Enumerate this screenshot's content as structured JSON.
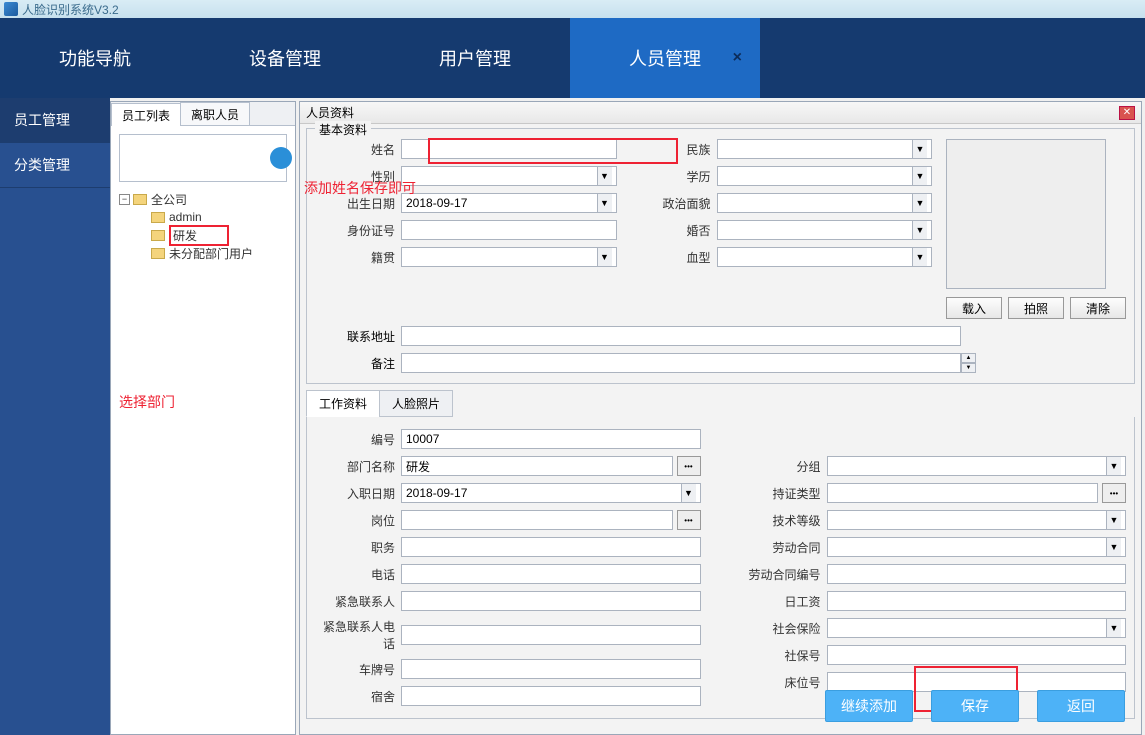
{
  "title": "人脸识别系统V3.2",
  "nav": [
    "功能导航",
    "设备管理",
    "用户管理",
    "人员管理"
  ],
  "sidebar": [
    "员工管理",
    "分类管理"
  ],
  "treeTabs": [
    "员工列表",
    "离职人员"
  ],
  "tree": {
    "root": "全公司",
    "children": [
      "admin",
      "研发",
      "未分配部门用户"
    ]
  },
  "annot": {
    "selectDept": "选择部门",
    "addName": "添加姓名保存即可"
  },
  "dialog": {
    "title": "人员资料",
    "basicTitle": "基本资料",
    "labels": {
      "name": "姓名",
      "gender": "性别",
      "birth": "出生日期",
      "idno": "身份证号",
      "origin": "籍贯",
      "addr": "联系地址",
      "remark": "备注",
      "nation": "民族",
      "edu": "学历",
      "politic": "政治面貌",
      "marry": "婚否",
      "blood": "血型"
    },
    "birthValue": "2018-09-17",
    "photoBtns": [
      "载入",
      "拍照",
      "清除"
    ],
    "subTabs": [
      "工作资料",
      "人脸照片"
    ],
    "work": {
      "labels": {
        "no": "编号",
        "dept": "部门名称",
        "hire": "入职日期",
        "post": "岗位",
        "duty": "职务",
        "tel": "电话",
        "contact": "紧急联系人",
        "contactTel": "紧急联系人电话",
        "car": "车牌号",
        "dorm": "宿舍",
        "group": "分组",
        "cert": "持证类型",
        "level": "技术等级",
        "labor": "劳动合同",
        "laborNo": "劳动合同编号",
        "daypay": "日工资",
        "social": "社会保险",
        "socialNo": "社保号",
        "bed": "床位号"
      },
      "noValue": "10007",
      "deptValue": "研发",
      "hireValue": "2018-09-17"
    },
    "btns": [
      "继续添加",
      "保存",
      "返回"
    ]
  }
}
